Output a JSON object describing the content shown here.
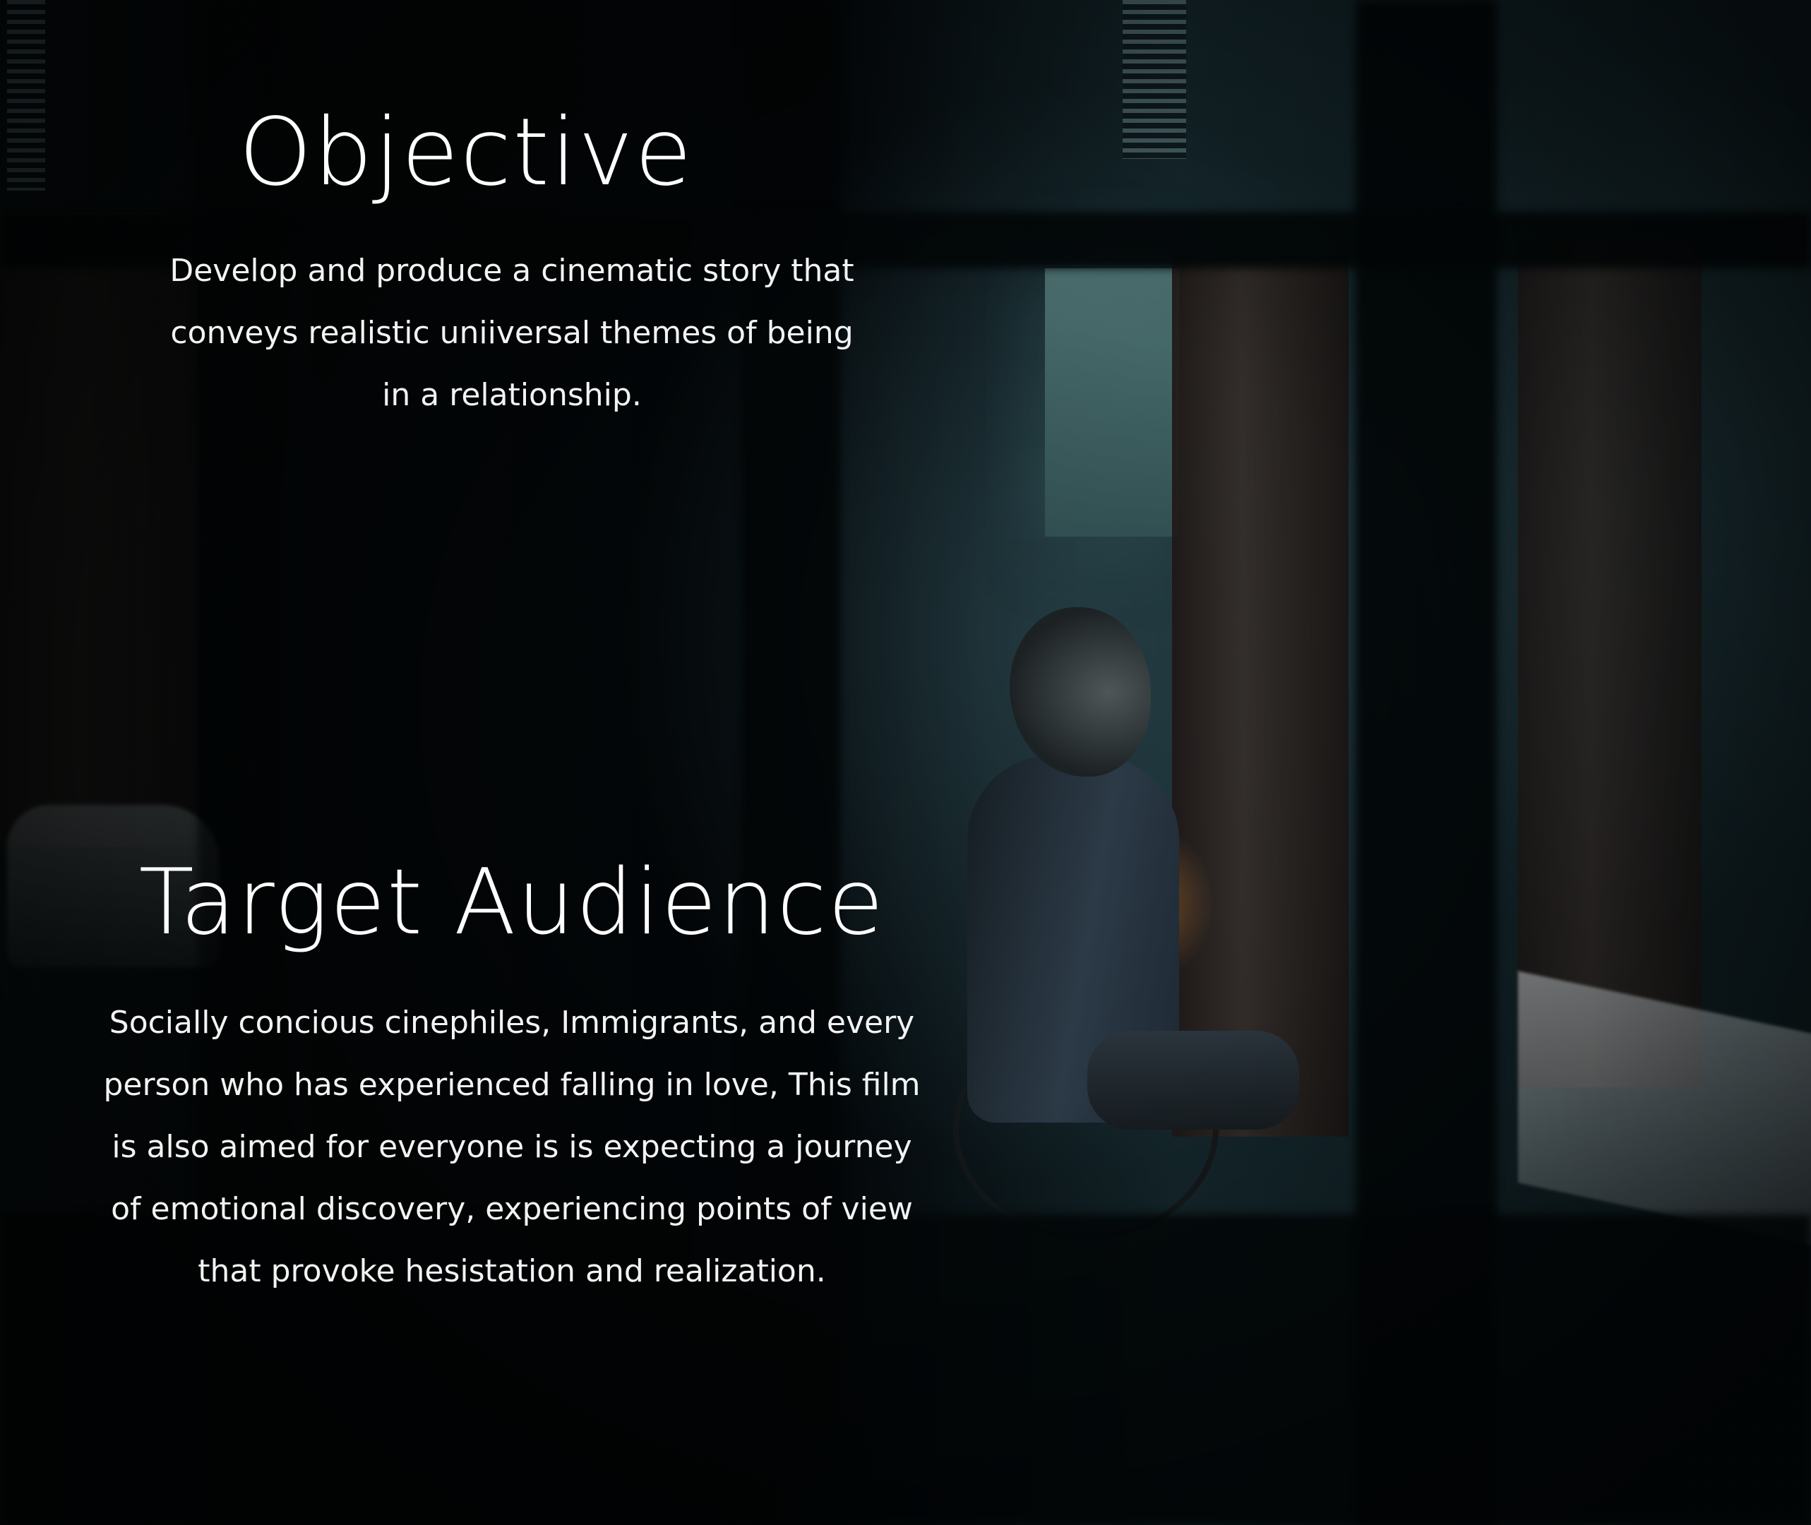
{
  "objective": {
    "title": "Objective",
    "body_lines": [
      "Develop and produce a cinematic story that",
      "conveys realistic uniiversal themes of being",
      "in a relationship."
    ]
  },
  "target_audience": {
    "title": "Target Audience",
    "body_lines": [
      "Socially concious cinephiles, Immigrants, and every",
      "person who has experienced falling in love, This film",
      "is also aimed for everyone is is expecting a journey",
      "of emotional discovery, experiencing points of view",
      "that provoke hesistation and realization."
    ]
  },
  "background": {
    "description_icon": "photo-background",
    "accent_colors": [
      "#050a0c",
      "#14262b",
      "#34545c"
    ]
  }
}
